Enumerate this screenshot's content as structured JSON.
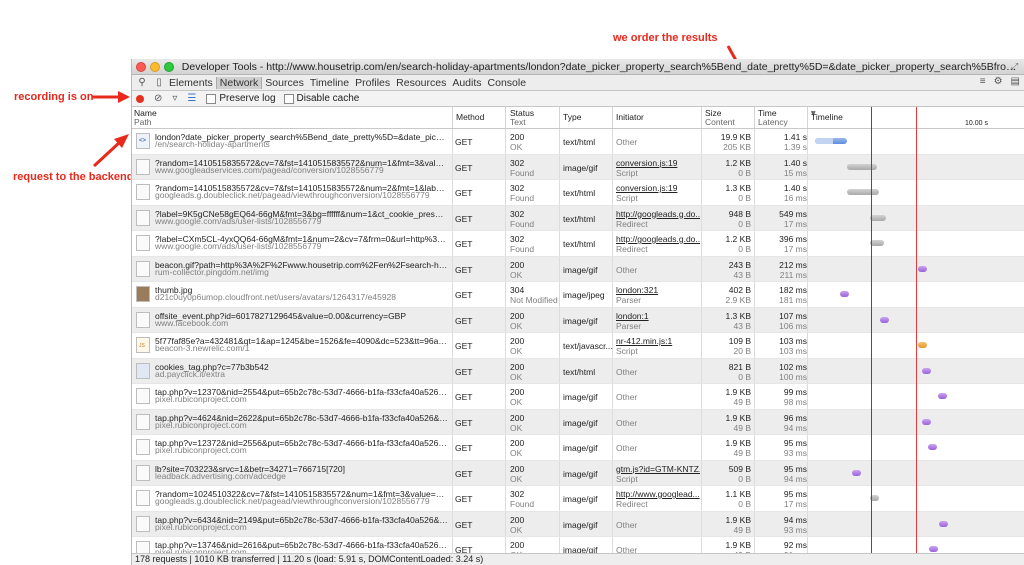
{
  "annotations": {
    "top": "we order the results",
    "left_top": "recording is on",
    "left_mid": "request to the backend"
  },
  "window": {
    "title": "Developer Tools - http://www.housetrip.com/en/search-holiday-apartments/london?date_picker_property_search%5Bend_date_pretty%5D=&date_picker_property_search%5Bfrom_date_pretty%5D=&origin=dr..."
  },
  "tabs": [
    "Elements",
    "Network",
    "Sources",
    "Timeline",
    "Profiles",
    "Resources",
    "Audits",
    "Console"
  ],
  "active_tab": "Network",
  "toolbar": {
    "preserve_log": "Preserve log",
    "disable_cache": "Disable cache"
  },
  "columns": {
    "name": "Name",
    "name_sub": "Path",
    "method": "Method",
    "status": "Status",
    "status_sub": "Text",
    "type": "Type",
    "initiator": "Initiator",
    "size": "Size",
    "size_sub": "Content",
    "time": "Time",
    "time_sub": "Latency",
    "timeline": "Timeline",
    "timeline_tick": "10.00 s"
  },
  "rows": [
    {
      "icon": "html",
      "name": "london?date_picker_property_search%5Bend_date_pretty%5D=&date_picker_property_...",
      "path": "/en/search-holiday-apartments",
      "method": "GET",
      "status": "200",
      "status_text": "OK",
      "type": "text/html",
      "initiator": "Other",
      "initiator_sub": "",
      "link": false,
      "size": "19.9 KB",
      "content": "205 KB",
      "time": "1.41 s",
      "latency": "1.39 s",
      "bar": "blue"
    },
    {
      "icon": "blank",
      "name": "?random=1410515835572&cv=7&fst=1410515835572&num=1&fmt=3&value=0&la...",
      "path": "www.googleadservices.com/pagead/conversion/1028556779",
      "method": "GET",
      "status": "302",
      "status_text": "Found",
      "type": "image/gif",
      "initiator": "conversion.js:19",
      "initiator_sub": "Script",
      "link": true,
      "size": "1.2 KB",
      "content": "0 B",
      "time": "1.40 s",
      "latency": "15 ms",
      "bar": "grey"
    },
    {
      "icon": "blank",
      "name": "?random=1410515835572&cv=7&fst=1410515835572&num=2&fmt=1&label=CXm...",
      "path": "googleads.g.doubleclick.net/pagead/viewthroughconversion/1028556779",
      "method": "GET",
      "status": "302",
      "status_text": "Found",
      "type": "text/html",
      "initiator": "conversion.js:19",
      "initiator_sub": "Script",
      "link": true,
      "size": "1.3 KB",
      "content": "0 B",
      "time": "1.40 s",
      "latency": "16 ms",
      "bar": "grey"
    },
    {
      "icon": "blank",
      "name": "?label=9K5gCNe58gEQ64-66gM&fmt=3&bg=ffffff&num=1&ct_cookie_present=false&...",
      "path": "www.google.com/ads/user-lists/1028556779",
      "method": "GET",
      "status": "302",
      "status_text": "Found",
      "type": "text/html",
      "initiator": "http://googleads.g.do...",
      "initiator_sub": "Redirect",
      "link": true,
      "size": "948 B",
      "content": "0 B",
      "time": "549 ms",
      "latency": "17 ms",
      "bar": "grey"
    },
    {
      "icon": "blank",
      "name": "?label=CXm5CL-4yxQQ64-66gM&fmt=1&num=2&cv=7&frm=0&url=http%3A%2F%2F...",
      "path": "www.google.com/ads/user-lists/1028556779",
      "method": "GET",
      "status": "302",
      "status_text": "Found",
      "type": "text/html",
      "initiator": "http://googleads.g.do...",
      "initiator_sub": "Redirect",
      "link": true,
      "size": "1.2 KB",
      "content": "0 B",
      "time": "396 ms",
      "latency": "17 ms",
      "bar": "grey"
    },
    {
      "icon": "blank",
      "name": "beacon.gif?path=http%3A%2F%2Fwww.housetrip.com%2Fen%2Fsearch-holiday-apartm...",
      "path": "rum-collector.pingdom.net/img",
      "method": "GET",
      "status": "200",
      "status_text": "OK",
      "type": "image/gif",
      "initiator": "Other",
      "initiator_sub": "",
      "link": false,
      "size": "243 B",
      "content": "43 B",
      "time": "212 ms",
      "latency": "211 ms",
      "bar": "purple"
    },
    {
      "icon": "img",
      "name": "thumb.jpg",
      "path": "d21c0uy0p6umop.cloudfront.net/users/avatars/1264317/e45928",
      "method": "GET",
      "status": "304",
      "status_text": "Not Modified",
      "type": "image/jpeg",
      "initiator": "london:321",
      "initiator_sub": "Parser",
      "link": true,
      "size": "402 B",
      "content": "2.9 KB",
      "time": "182 ms",
      "latency": "181 ms",
      "bar": "purple"
    },
    {
      "icon": "blank",
      "name": "offsite_event.php?id=6017827129645&value=0.00&currency=GBP",
      "path": "www.facebook.com",
      "method": "GET",
      "status": "200",
      "status_text": "OK",
      "type": "image/gif",
      "initiator": "london:1",
      "initiator_sub": "Parser",
      "link": true,
      "size": "1.3 KB",
      "content": "43 B",
      "time": "107 ms",
      "latency": "106 ms",
      "bar": "purple"
    },
    {
      "icon": "js",
      "name": "5f77faf85e?a=432481&qt=1&ap=1245&be=1526&fe=4090&dc=523&tt=96a17459a...",
      "path": "beacon-3.newrelic.com/1",
      "method": "GET",
      "status": "200",
      "status_text": "OK",
      "type": "text/javascr...",
      "initiator": "nr-412.min.js:1",
      "initiator_sub": "Script",
      "link": true,
      "size": "109 B",
      "content": "20 B",
      "time": "103 ms",
      "latency": "103 ms",
      "bar": "orange"
    },
    {
      "icon": "pic",
      "name": "cookies_tag.php?c=77b3b542",
      "path": "ad.payclick.it/extra",
      "method": "GET",
      "status": "200",
      "status_text": "OK",
      "type": "text/html",
      "initiator": "Other",
      "initiator_sub": "",
      "link": false,
      "size": "821 B",
      "content": "0 B",
      "time": "102 ms",
      "latency": "100 ms",
      "bar": "purple"
    },
    {
      "icon": "blank",
      "name": "tap.php?v=12370&nid=2554&put=65b2c78c-53d7-4666-b1fa-f33cfa40a526&expir...",
      "path": "pixel.rubiconproject.com",
      "method": "GET",
      "status": "200",
      "status_text": "OK",
      "type": "image/gif",
      "initiator": "Other",
      "initiator_sub": "",
      "link": false,
      "size": "1.9 KB",
      "content": "49 B",
      "time": "99 ms",
      "latency": "98 ms",
      "bar": "purple"
    },
    {
      "icon": "blank",
      "name": "tap.php?v=4624&nid=2622&put=65b2c78c-53d7-4666-b1fa-f33cfa40a526&expire...",
      "path": "pixel.rubiconproject.com",
      "method": "GET",
      "status": "200",
      "status_text": "OK",
      "type": "image/gif",
      "initiator": "Other",
      "initiator_sub": "",
      "link": false,
      "size": "1.9 KB",
      "content": "49 B",
      "time": "96 ms",
      "latency": "94 ms",
      "bar": "purple"
    },
    {
      "icon": "blank",
      "name": "tap.php?v=12372&nid=2556&put=65b2c78c-53d7-4666-b1fa-f33cfa40a526&expir...",
      "path": "pixel.rubiconproject.com",
      "method": "GET",
      "status": "200",
      "status_text": "OK",
      "type": "image/gif",
      "initiator": "Other",
      "initiator_sub": "",
      "link": false,
      "size": "1.9 KB",
      "content": "49 B",
      "time": "95 ms",
      "latency": "93 ms",
      "bar": "purple"
    },
    {
      "icon": "blank",
      "name": "lb?site=703223&srvc=1&betr=34271=766715[720]",
      "path": "leadback.advertising.com/adcedge",
      "method": "GET",
      "status": "200",
      "status_text": "OK",
      "type": "image/gif",
      "initiator": "gtm.js?id=GTM-KNTZ...",
      "initiator_sub": "Script",
      "link": true,
      "size": "509 B",
      "content": "0 B",
      "time": "95 ms",
      "latency": "94 ms",
      "bar": "purple"
    },
    {
      "icon": "blank",
      "name": "?random=1024510322&cv=7&fst=1410515835572&num=1&fmt=3&value=0&label=...",
      "path": "googleads.g.doubleclick.net/pagead/viewthroughconversion/1028556779",
      "method": "GET",
      "status": "302",
      "status_text": "Found",
      "type": "image/gif",
      "initiator": "http://www.googlead...",
      "initiator_sub": "Redirect",
      "link": true,
      "size": "1.1 KB",
      "content": "0 B",
      "time": "95 ms",
      "latency": "17 ms",
      "bar": "grey"
    },
    {
      "icon": "blank",
      "name": "tap.php?v=6434&nid=2149&put=65b2c78c-53d7-4666-b1fa-f33cfa40a526&expire...",
      "path": "pixel.rubiconproject.com",
      "method": "GET",
      "status": "200",
      "status_text": "OK",
      "type": "image/gif",
      "initiator": "Other",
      "initiator_sub": "",
      "link": false,
      "size": "1.9 KB",
      "content": "49 B",
      "time": "94 ms",
      "latency": "93 ms",
      "bar": "purple"
    },
    {
      "icon": "blank",
      "name": "tap.php?v=13746&nid=2616&put=65b2c78c-53d7-4666-b1fa-f33cfa40a526&expir...",
      "path": "pixel.rubiconproject.com",
      "method": "GET",
      "status": "200",
      "status_text": "OK",
      "type": "image/gif",
      "initiator": "Other",
      "initiator_sub": "",
      "link": false,
      "size": "1.9 KB",
      "content": "49 B",
      "time": "92 ms",
      "latency": "91 ms",
      "bar": "purple"
    }
  ],
  "statusbar": "178 requests | 1010 KB transferred | 11.20 s (load: 5.91 s, DOMContentLoaded: 3.24 s)"
}
